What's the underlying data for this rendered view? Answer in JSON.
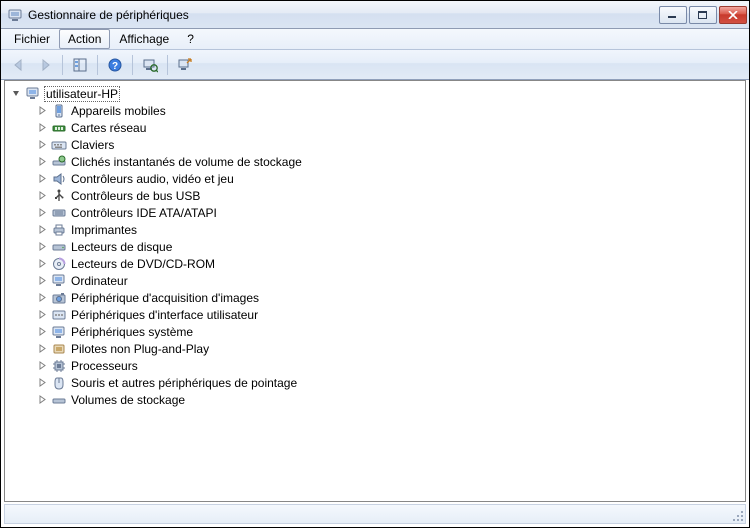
{
  "window": {
    "title": "Gestionnaire de périphériques"
  },
  "menu": {
    "file": "Fichier",
    "action": "Action",
    "view": "Affichage",
    "help": "?"
  },
  "tree": {
    "root": "utilisateur-HP",
    "items": [
      {
        "icon": "mobile",
        "label": "Appareils mobiles"
      },
      {
        "icon": "network",
        "label": "Cartes réseau"
      },
      {
        "icon": "keyboard",
        "label": "Claviers"
      },
      {
        "icon": "snapshot",
        "label": "Clichés instantanés de volume de stockage"
      },
      {
        "icon": "audio",
        "label": "Contrôleurs audio, vidéo et jeu"
      },
      {
        "icon": "usb",
        "label": "Contrôleurs de bus USB"
      },
      {
        "icon": "ide",
        "label": "Contrôleurs IDE ATA/ATAPI"
      },
      {
        "icon": "printer",
        "label": "Imprimantes"
      },
      {
        "icon": "disk",
        "label": "Lecteurs de disque"
      },
      {
        "icon": "dvdrom",
        "label": "Lecteurs de DVD/CD-ROM"
      },
      {
        "icon": "computer",
        "label": "Ordinateur"
      },
      {
        "icon": "camera",
        "label": "Périphérique d'acquisition d'images"
      },
      {
        "icon": "hid",
        "label": "Périphériques d'interface utilisateur"
      },
      {
        "icon": "system",
        "label": "Périphériques système"
      },
      {
        "icon": "nonpnp",
        "label": "Pilotes non Plug-and-Play"
      },
      {
        "icon": "cpu",
        "label": "Processeurs"
      },
      {
        "icon": "mouse",
        "label": "Souris et autres périphériques de pointage"
      },
      {
        "icon": "volume",
        "label": "Volumes de stockage"
      }
    ]
  }
}
